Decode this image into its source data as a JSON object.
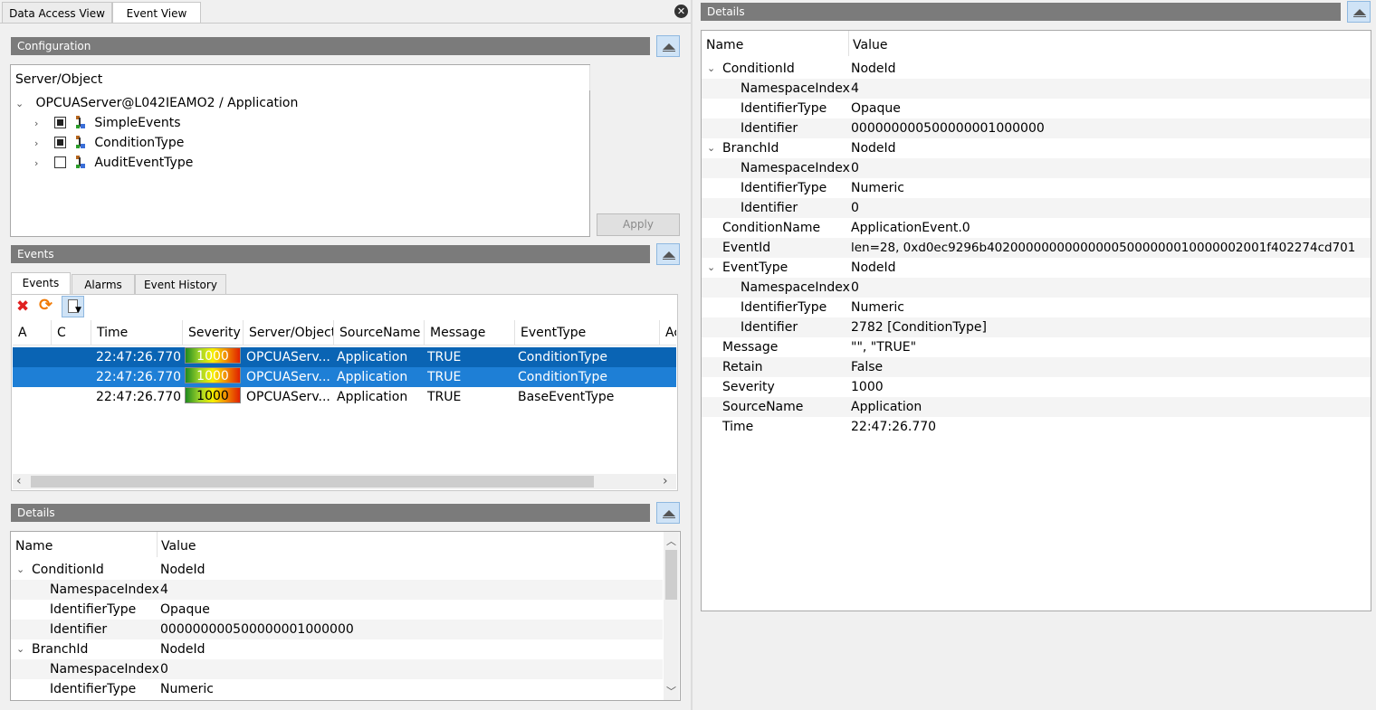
{
  "doc_tabs": [
    {
      "label": "Data Access View",
      "active": false
    },
    {
      "label": "Event View",
      "active": true
    }
  ],
  "configuration": {
    "title": "Configuration",
    "column_header": "Server/Object",
    "server_node": "OPCUAServer@L042IEAMO2 / Application",
    "items": [
      {
        "label": "SimpleEvents",
        "checked": true
      },
      {
        "label": "ConditionType",
        "checked": true
      },
      {
        "label": "AuditEventType",
        "checked": false
      }
    ],
    "apply_label": "Apply"
  },
  "events": {
    "title": "Events",
    "tabs": [
      "Events",
      "Alarms",
      "Event History"
    ],
    "columns": [
      "A",
      "C",
      "Time",
      "Severity",
      "Server/Object",
      "SourceName",
      "Message",
      "EventType",
      "Ac"
    ],
    "rows": [
      {
        "time": "22:47:26.770",
        "severity": "1000",
        "server": "OPCUAServ...",
        "source": "Application",
        "message": "TRUE",
        "type": "ConditionType"
      },
      {
        "time": "22:47:26.770",
        "severity": "1000",
        "server": "OPCUAServ...",
        "source": "Application",
        "message": "TRUE",
        "type": "ConditionType"
      },
      {
        "time": "22:47:26.770",
        "severity": "1000",
        "server": "OPCUAServ...",
        "source": "Application",
        "message": "TRUE",
        "type": "BaseEventType"
      }
    ]
  },
  "details_left": {
    "title": "Details",
    "col_name": "Name",
    "col_value": "Value",
    "rows": [
      {
        "name": "ConditionId",
        "value": "NodeId",
        "level": 0,
        "expander": true
      },
      {
        "name": "NamespaceIndex",
        "value": "4",
        "level": 1
      },
      {
        "name": "IdentifierType",
        "value": "Opaque",
        "level": 1
      },
      {
        "name": "Identifier",
        "value": "00000000050000000100000​0",
        "level": 1
      },
      {
        "name": "BranchId",
        "value": "NodeId",
        "level": 0,
        "expander": true
      },
      {
        "name": "NamespaceIndex",
        "value": "0",
        "level": 1
      },
      {
        "name": "IdentifierType",
        "value": "Numeric",
        "level": 1
      }
    ]
  },
  "details_right": {
    "title": "Details",
    "col_name": "Name",
    "col_value": "Value",
    "rows": [
      {
        "name": "ConditionId",
        "value": "NodeId",
        "level": 0,
        "expander": true
      },
      {
        "name": "NamespaceIndex",
        "value": "4",
        "level": 1
      },
      {
        "name": "IdentifierType",
        "value": "Opaque",
        "level": 1
      },
      {
        "name": "Identifier",
        "value": "000000000500000001000000",
        "level": 1
      },
      {
        "name": "BranchId",
        "value": "NodeId",
        "level": 0,
        "expander": true
      },
      {
        "name": "NamespaceIndex",
        "value": "0",
        "level": 1
      },
      {
        "name": "IdentifierType",
        "value": "Numeric",
        "level": 1
      },
      {
        "name": "Identifier",
        "value": "0",
        "level": 1
      },
      {
        "name": "ConditionName",
        "value": "ApplicationEvent.0",
        "level": 0
      },
      {
        "name": "EventId",
        "value": "len=28, 0xd0ec9296b402000000000000005000000010000002001f402274cd701",
        "level": 0
      },
      {
        "name": "EventType",
        "value": "NodeId",
        "level": 0,
        "expander": true
      },
      {
        "name": "NamespaceIndex",
        "value": "0",
        "level": 1
      },
      {
        "name": "IdentifierType",
        "value": "Numeric",
        "level": 1
      },
      {
        "name": "Identifier",
        "value": "2782 [ConditionType]",
        "level": 1
      },
      {
        "name": "Message",
        "value": "\"\", \"TRUE\"",
        "level": 0
      },
      {
        "name": "Retain",
        "value": "False",
        "level": 0
      },
      {
        "name": "Severity",
        "value": "1000",
        "level": 0
      },
      {
        "name": "SourceName",
        "value": "Application",
        "level": 0
      },
      {
        "name": "Time",
        "value": "22:47:26.770",
        "level": 0
      }
    ]
  }
}
